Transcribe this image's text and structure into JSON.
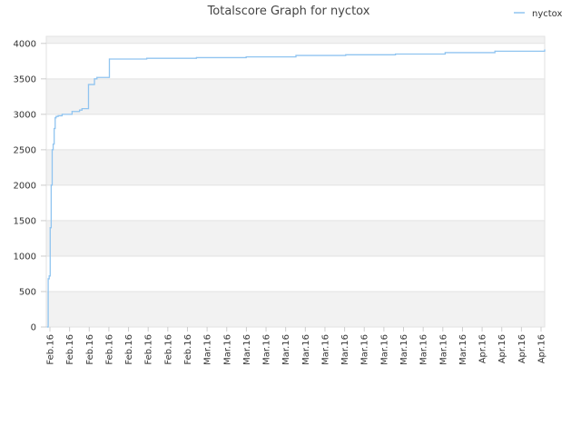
{
  "chart_data": {
    "type": "line",
    "title": "Totalscore Graph for nyctox",
    "xlabel": "",
    "ylabel": "",
    "ylim": [
      0,
      4100
    ],
    "yticks": [
      0,
      500,
      1000,
      1500,
      2000,
      2500,
      3000,
      3500,
      4000
    ],
    "xtick_labels": [
      "Feb.16",
      "Feb.16",
      "Feb.16",
      "Feb.16",
      "Feb.16",
      "Feb.16",
      "Feb.16",
      "Feb.16",
      "Mar.16",
      "Mar.16",
      "Mar.16",
      "Mar.16",
      "Mar.16",
      "Mar.16",
      "Mar.16",
      "Mar.16",
      "Mar.16",
      "Mar.16",
      "Mar.16",
      "Mar.16",
      "Mar.16",
      "Mar.16",
      "Apr.16",
      "Apr.16",
      "Apr.16",
      "Apr.16"
    ],
    "grid": true,
    "legend_position": "top-right",
    "colors": {
      "series": "#90c4f0",
      "band": "#f2f2f2",
      "grid": "#e2e2e2",
      "axis": "#cccccc"
    },
    "series": [
      {
        "name": "nyctox",
        "x": [
          0.0,
          0.2,
          0.4,
          0.6,
          0.8,
          1.0,
          1.2,
          1.4,
          1.6,
          1.8,
          2.2,
          3.0,
          5.0,
          6.5,
          7.0,
          8.3,
          9.5,
          10.0,
          12.5,
          20.0,
          30.0,
          40.0,
          50.0,
          60.0,
          70.0,
          80.0,
          90.0,
          100.0
        ],
        "y": [
          0,
          680,
          720,
          1400,
          2000,
          2500,
          2580,
          2800,
          2950,
          2970,
          2980,
          3000,
          3040,
          3060,
          3080,
          3420,
          3500,
          3520,
          3780,
          3790,
          3800,
          3810,
          3830,
          3840,
          3850,
          3870,
          3890,
          3910
        ]
      }
    ]
  }
}
